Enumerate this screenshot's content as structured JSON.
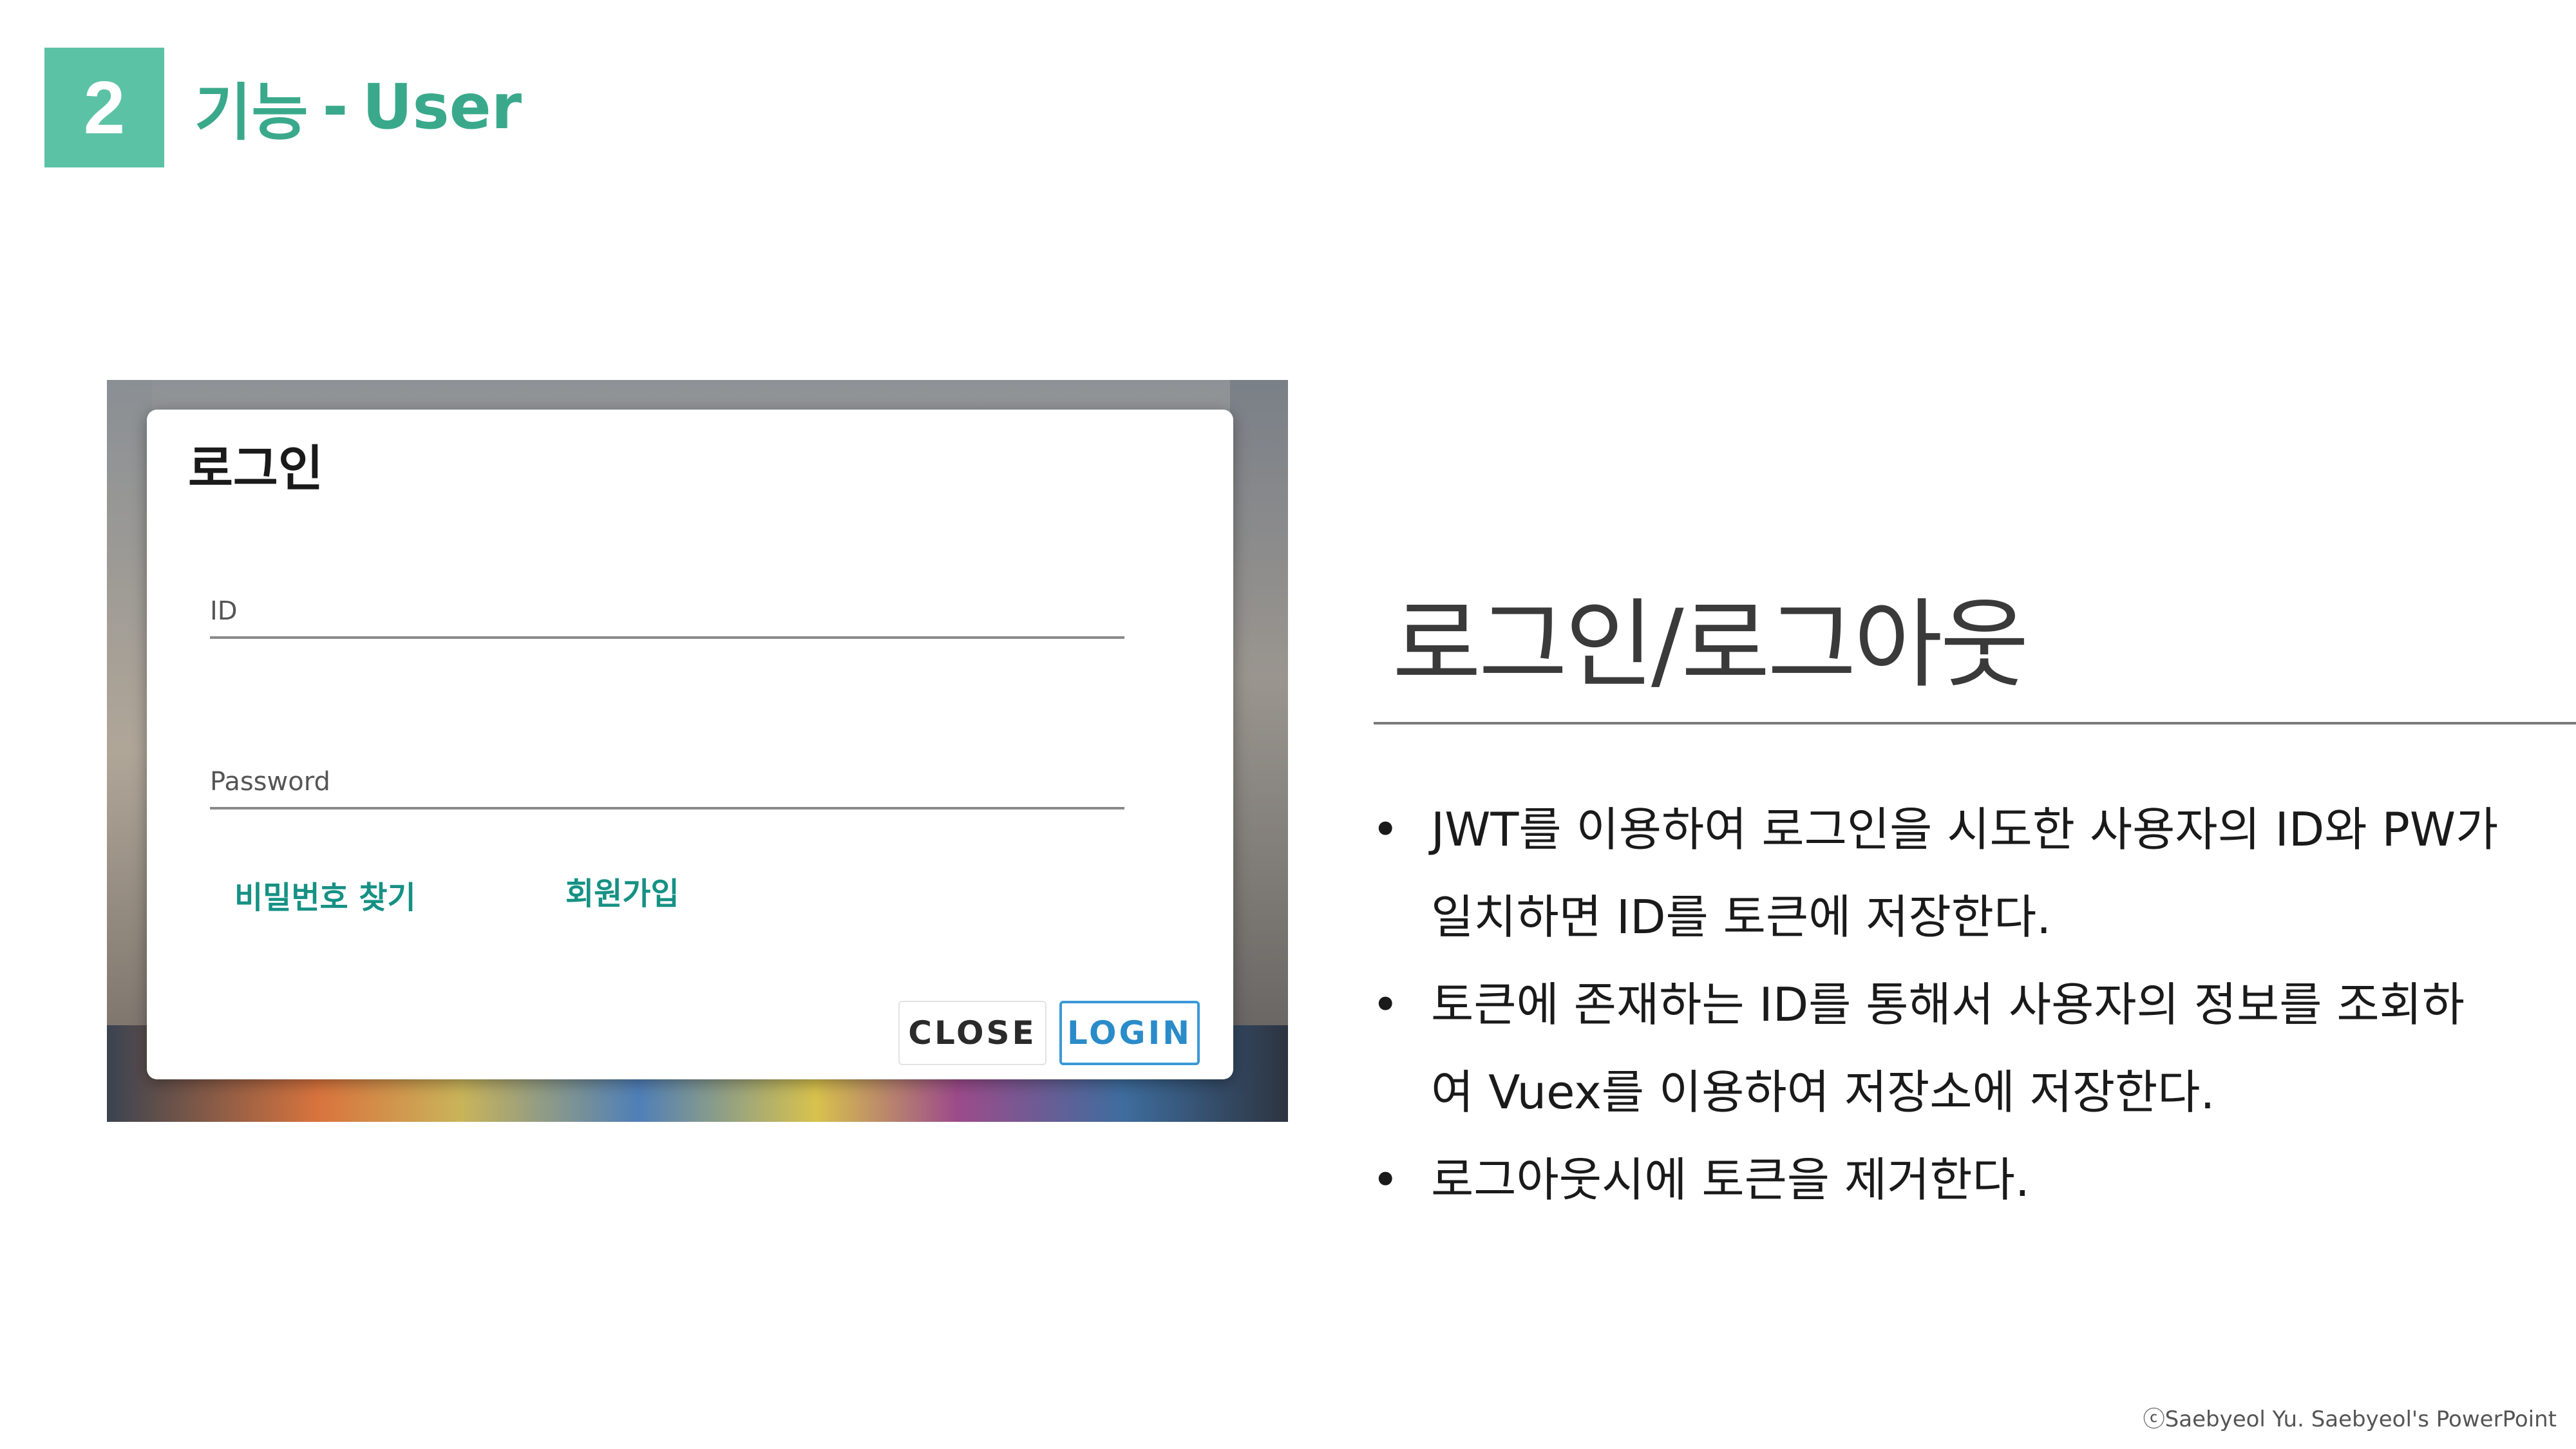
{
  "header": {
    "section_number": "2",
    "title_ko": "기능",
    "separator": "-",
    "title_en": "User"
  },
  "login_dialog": {
    "title": "로그인",
    "id_label": "ID",
    "password_label": "Password",
    "find_password_link": "비밀번호 찾기",
    "signup_link": "회원가입",
    "close_button": "CLOSE",
    "login_button": "LOGIN"
  },
  "topic": {
    "title": "로그인/로그아웃",
    "bullets": [
      "JWT를 이용하여 로그인을 시도한 사용자의 ID와 PW가 일치하면 ID를 토큰에 저장한다.",
      "토큰에 존재하는 ID를 통해서 사용자의 정보를 조회하여 Vuex를 이용하여 저장소에 저장한다.",
      "로그아웃시에 토큰을 제거한다."
    ],
    "bullet_symbol": "•"
  },
  "footer": {
    "copyright": "ⓒSaebyeol Yu. Saebyeol's PowerPoint"
  },
  "colors": {
    "accent": "#5cc2a6",
    "accent_text": "#3aa98b",
    "link": "#159184",
    "login_button": "#2a8bc9"
  }
}
